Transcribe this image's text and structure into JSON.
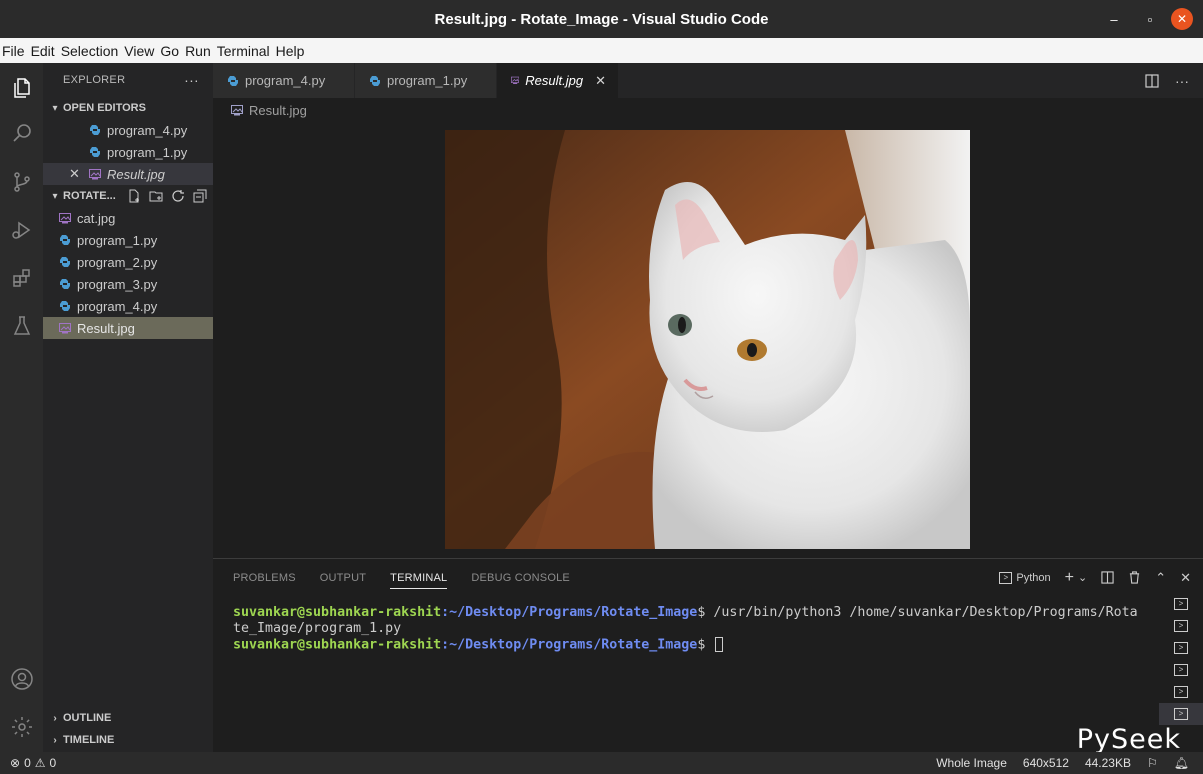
{
  "window": {
    "title": "Result.jpg - Rotate_Image - Visual Studio Code",
    "min": "–",
    "max": "▫",
    "close": "✕"
  },
  "menu": [
    "File",
    "Edit",
    "Selection",
    "View",
    "Go",
    "Run",
    "Terminal",
    "Help"
  ],
  "sidebar": {
    "header": "EXPLORER",
    "more": "···",
    "open_editors": {
      "label": "OPEN EDITORS",
      "items": [
        "program_4.py",
        "program_1.py",
        "Result.jpg"
      ]
    },
    "folder": {
      "label": "ROTATE...",
      "files": [
        "cat.jpg",
        "program_1.py",
        "program_2.py",
        "program_3.py",
        "program_4.py",
        "Result.jpg"
      ]
    },
    "outline": "OUTLINE",
    "timeline": "TIMELINE"
  },
  "tabs": [
    {
      "label": "program_4.py"
    },
    {
      "label": "program_1.py"
    },
    {
      "label": "Result.jpg",
      "active": true
    }
  ],
  "breadcrumb": "Result.jpg",
  "panel": {
    "tabs": [
      "PROBLEMS",
      "OUTPUT",
      "TERMINAL",
      "DEBUG CONSOLE"
    ],
    "active_tab": "TERMINAL",
    "shell": "Python",
    "terminal": {
      "line1_user": "suvankar@subhankar-rakshit",
      "line1_path": ":~/Desktop/Programs/Rotate_Image",
      "line1_cmd": "$ /usr/bin/python3 /home/suvankar/Desktop/Programs/Rota",
      "line2": "te_Image/program_1.py",
      "line3_user": "suvankar@subhankar-rakshit",
      "line3_path": ":~/Desktop/Programs/Rotate_Image",
      "line3_cmd": "$ "
    },
    "terminal_count": 6
  },
  "statusbar": {
    "errors": "0",
    "warnings": "0",
    "zoom": "Whole Image",
    "dimensions": "640x512",
    "size": "44.23KB"
  },
  "watermark": "PySeek",
  "colors": {
    "accent": "#e95420",
    "selection": "#6b6a5a",
    "python_icon": "#4b9cd3"
  }
}
